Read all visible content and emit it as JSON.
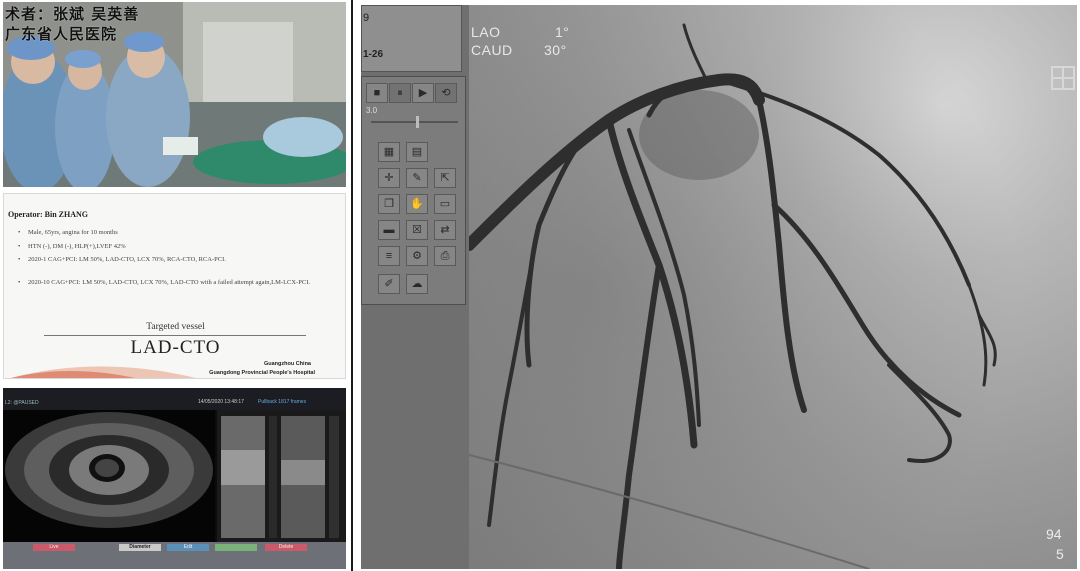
{
  "camera": {
    "overlay_line1": "术者：张斌  吴英善",
    "overlay_line2": "广东省人民医院"
  },
  "slide": {
    "operator": "Operator: Bin ZHANG",
    "bullets": [
      "Male, 65yrs, angina for 10 months",
      "HTN (-), DM (-), HLP(+),LVEF 42%",
      "2020-1 CAG+PCI: LM 50%, LAD-CTO, LCX 70%, RCA-CTO, RCA-PCI.",
      "2020-10 CAG+PCI: LM 50%, LAD-CTO, LCX 70%, LAD-CTO with a failed attempt again,LM-LCX-PCI."
    ],
    "target_label": "Targeted vessel",
    "target_name": "LAD-CTO",
    "city": "Guangzhou China",
    "hospital": "Guangdong Provincial People's Hospital"
  },
  "ivus": {
    "tag_left": "L2: @PAUSED",
    "timestamp": "14/05/2020 13:48:17",
    "right_label": "Pullback 1817 frames",
    "buttons": [
      {
        "label": "Live",
        "color": "#c85a6a"
      },
      {
        "label": "Diameter",
        "color": "#cfcfcf"
      },
      {
        "label": "Edit",
        "color": "#5a8fb8"
      },
      {
        "label": "",
        "color": "#7ab07a"
      },
      {
        "label": "Delete",
        "color": "#c85a6a"
      }
    ]
  },
  "viewer": {
    "frame_top": "9",
    "frame_series": "1-26",
    "speed": "3.0",
    "projection": {
      "line1_name": "LAO",
      "line1_value": "1°",
      "line2_name": "CAUD",
      "line2_value": "30°"
    },
    "counter_top": "94",
    "counter_bottom": "5",
    "toolbar_icons": [
      "stop-icon",
      "pause-icon",
      "play-icon",
      "loop-icon",
      "grid-view-icon",
      "grid-view-alt-icon",
      "crosshair-icon",
      "pan-icon",
      "pen-icon",
      "export-icon",
      "layers-icon",
      "copy-icon",
      "hand-icon",
      "film-icon",
      "folder-icon",
      "close-box-icon",
      "swap-icon",
      "list-icon",
      "settings-icon",
      "printer-icon",
      "wrench-icon",
      "brain-icon"
    ]
  }
}
